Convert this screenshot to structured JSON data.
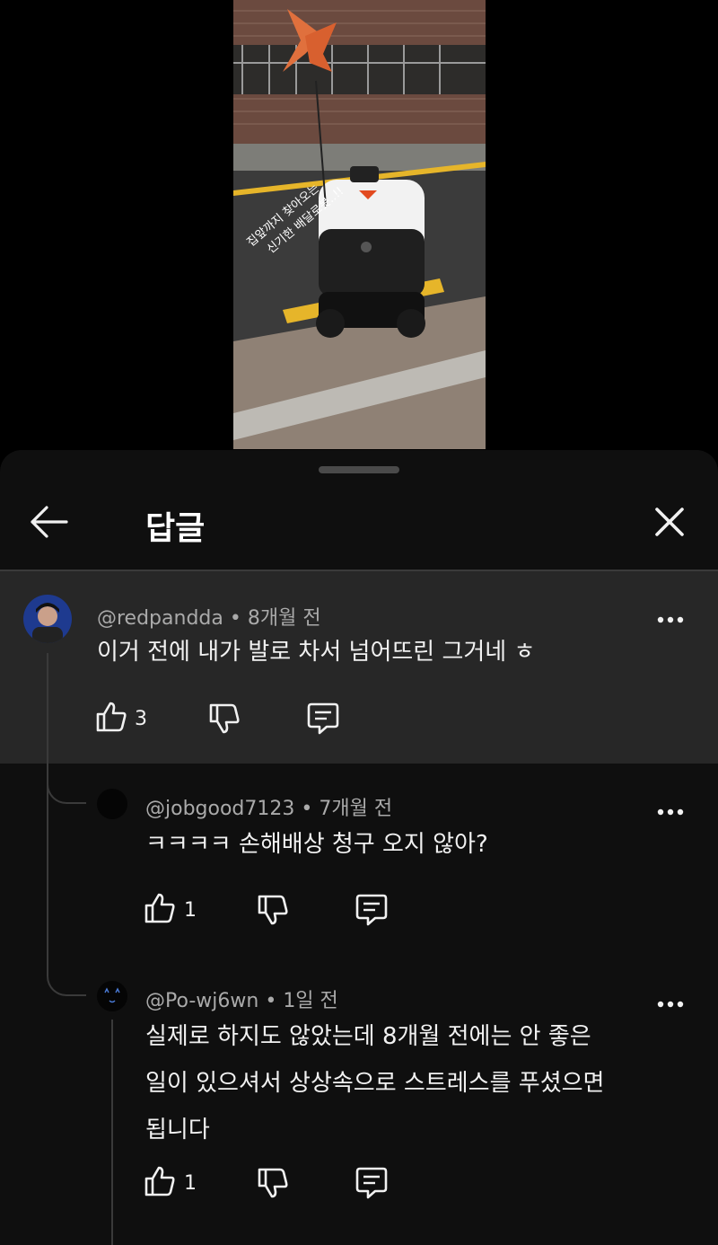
{
  "header": {
    "title": "답글"
  },
  "video": {
    "overlay_text_line1": "집앞까지 찾아오는",
    "overlay_text_line2": "신기한 배달로봇..!!"
  },
  "comments": [
    {
      "author": "@redpandda",
      "time": "8개월 전",
      "text": "이거 전에 내가 발로 차서 넘어뜨린 그거네 ㅎ",
      "likes": "3"
    },
    {
      "author": "@jobgood7123",
      "time": "7개월 전",
      "text": "ㅋㅋㅋㅋ 손해배상 청구 오지 않아?",
      "likes": "1"
    },
    {
      "author": "@Po-wj6wn",
      "time": "1일 전",
      "text_lines": [
        "실제로 하지도 않았는데 8개월 전에는 안 좋은",
        "일이 있으셔서 상상속으로 스트레스를 푸셨으면",
        "됩니다"
      ],
      "likes": "1"
    }
  ],
  "separator": "•",
  "colors": {
    "sheet_bg": "#0f0f0f",
    "highlight_bg": "#272727",
    "meta_text": "#aaaaaa",
    "text": "#f1f1f1"
  },
  "icons": [
    "back-arrow-icon",
    "close-icon",
    "more-options-icon",
    "thumbs-up-icon",
    "thumbs-down-icon",
    "reply-icon"
  ]
}
